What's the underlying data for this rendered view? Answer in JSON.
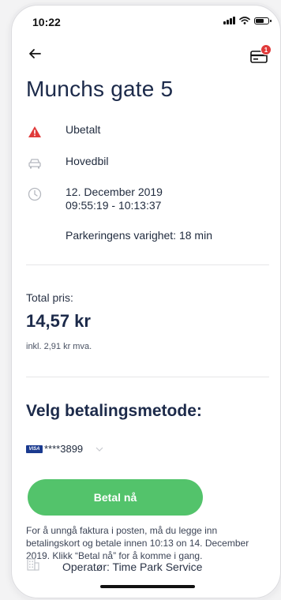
{
  "status": {
    "time": "10:22"
  },
  "header": {
    "badge_count": "1"
  },
  "parking": {
    "title": "Munchs gate 5",
    "status": "Ubetalt",
    "vehicle": "Hovedbil",
    "date": "12. December 2019",
    "time_range": "09:55:19 - 10:13:37",
    "duration": "Parkeringens varighet: 18 min"
  },
  "price": {
    "label": "Total pris:",
    "amount": "14,57 kr",
    "vat": "inkl. 2,91 kr mva."
  },
  "payment": {
    "title": "Velg betalingsmetode:",
    "card_brand": "VISA",
    "card_number": "****3899",
    "pay_button": "Betal nå",
    "info": "For å unngå faktura i posten, må du legge inn betalingskort og betale innen 10:13 on 14. December 2019. Klikk “Betal nå” for å komme i gang.",
    "operator": "Operatør: Time Park Service"
  },
  "colors": {
    "accent_green": "#53c36b",
    "warning_red": "#e03a3a",
    "title_navy": "#1c2a4a",
    "visa_blue": "#1a3a8f"
  },
  "icons": {
    "back": "arrow-left-icon",
    "card": "credit-card-icon",
    "status": "warning-triangle-icon",
    "vehicle": "car-icon",
    "time": "clock-icon",
    "operator": "building-icon",
    "dropdown": "chevron-down-icon"
  }
}
